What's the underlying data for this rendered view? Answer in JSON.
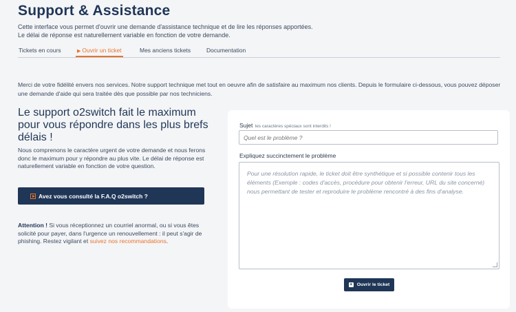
{
  "page": {
    "title": "Support & Assistance",
    "intro_line1": "Cette interface vous permet d'ouvrir une demande d'assistance technique et de lire les réponses apportées.",
    "intro_line2": "Le délai de réponse est naturellement variable en fonction de votre demande."
  },
  "tabs": [
    {
      "label": "Tickets en cours",
      "active": false
    },
    {
      "label": "Ouvrir un ticket",
      "active": true
    },
    {
      "label": "Mes anciens tickets",
      "active": false
    },
    {
      "label": "Documentation",
      "active": false
    }
  ],
  "thanks_text": "Merci de votre fidélité envers nos services. Notre support technique met tout en oeuvre afin de satisfaire au maximum nos clients. Depuis le formulaire ci-dessous, vous pouvez déposer une demande d'aide qui sera traitée dès que possible par nos techniciens.",
  "left": {
    "headline": "Le support o2switch fait le maximum pour vous répondre dans les plus brefs délais !",
    "description": "Nous comprenons le caractère urgent de votre demande et nous ferons donc le maximum pour y répondre au plus vite. Le délai de réponse est naturellement variable en fonction de votre question.",
    "faq_button": "Avez vous consulté la F.A.Q o2switch ?",
    "attention_label": "Attention !",
    "attention_text": " Si vous réceptionnez un courriel anormal, ou si vous êtes solicité pour payer, dans l'urgence un renouvellement : il peut s'agir de phishing. Restez vigilant et ",
    "attention_link": "suivez nos recommandations",
    "attention_end": "."
  },
  "form": {
    "subject_label": "Sujet",
    "subject_hint": "les caractères spéciaux sont interdits !",
    "subject_placeholder": "Quel est le problème ?",
    "problem_label": "Expliquez succinctement le problème",
    "problem_placeholder": "Pour une résolution rapide, le ticket doit être synthétique et si possible contenir tous les éléments (Exemple : codes d'accès, procédure pour obtenir l'erreur, URL du site concerné) nous permettant de tester et reproduire le problème rencontré à des fins d'analyse.",
    "submit_label": "Ouvrir le ticket"
  },
  "colors": {
    "accent": "#e8732b",
    "primary": "#1f3656",
    "background": "#f4f5f7"
  },
  "icons": {
    "tab_active": "triangle-right-icon",
    "faq": "play-icon",
    "submit": "plus-icon"
  }
}
